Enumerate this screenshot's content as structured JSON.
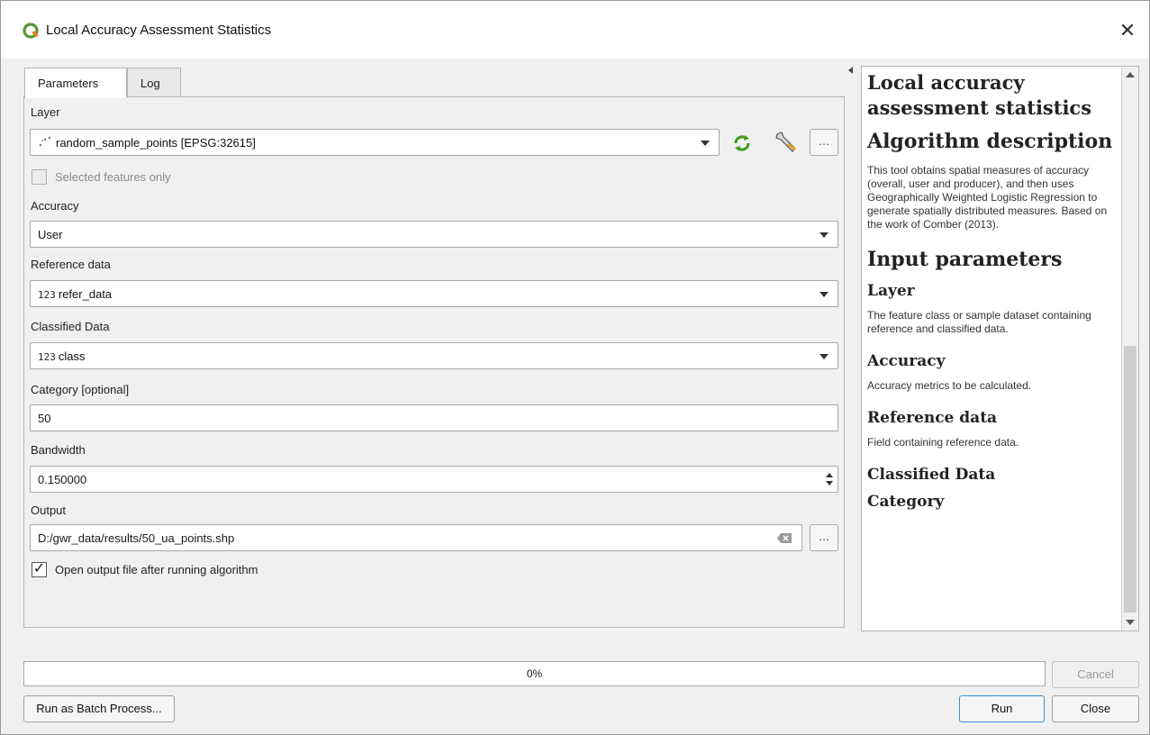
{
  "window": {
    "title": "Local Accuracy Assessment Statistics",
    "close_glyph": "✕"
  },
  "tabs": [
    {
      "label": "Parameters",
      "active": true
    },
    {
      "label": "Log",
      "active": false
    }
  ],
  "params": {
    "layer_label": "Layer",
    "layer_value": "random_sample_points [EPSG:32615]",
    "layer_icon": "point-layer-icon",
    "selected_only_label": "Selected features only",
    "selected_only_checked": false,
    "accuracy_label": "Accuracy",
    "accuracy_value": "User",
    "reference_label": "Reference data",
    "reference_prefix": "123",
    "reference_value": "refer_data",
    "classified_label": "Classified Data",
    "classified_prefix": "123",
    "classified_value": "class",
    "category_label": "Category [optional]",
    "category_value": "50",
    "bandwidth_label": "Bandwidth",
    "bandwidth_value": "0.150000",
    "output_label": "Output",
    "output_value": "D:/gwr_data/results/50_ua_points.shp",
    "open_output_label": "Open output file after running algorithm",
    "open_output_checked": true,
    "ellipsis": "…"
  },
  "help": {
    "title": "Local accuracy assessment statistics",
    "algo_heading": "Algorithm description",
    "algo_text": "This tool obtains spatial measures of accuracy (overall, user and producer), and then uses Geographically Weighted Logistic Regression to generate spatially distributed measures. Based on the work of Comber (2013).",
    "input_heading": "Input parameters",
    "layer_heading": "Layer",
    "layer_text": "The feature class or sample dataset containing reference and classified data.",
    "accuracy_heading": "Accuracy",
    "accuracy_text": "Accuracy metrics to be calculated.",
    "reference_heading": "Reference data",
    "reference_text": "Field containing reference data.",
    "classified_heading": "Classified Data",
    "category_heading": "Category"
  },
  "progress": {
    "percent": 0,
    "text": "0%"
  },
  "buttons": {
    "cancel": "Cancel",
    "batch": "Run as Batch Process...",
    "run": "Run",
    "close": "Close"
  },
  "colors": {
    "accent": "#3b8ed6",
    "qgis_green": "#589632",
    "qgis_yellow": "#ee7913"
  }
}
